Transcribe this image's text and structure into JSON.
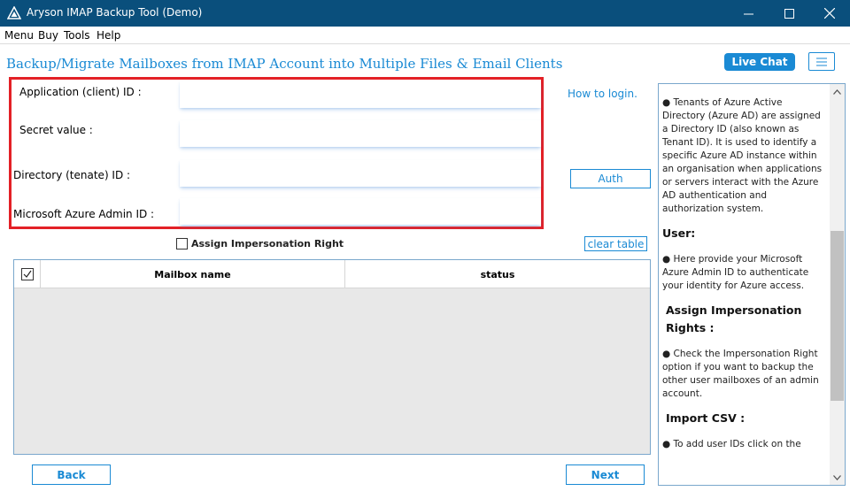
{
  "window": {
    "title": "Aryson IMAP Backup Tool (Demo)",
    "minimize_glyph": "—",
    "maximize_glyph": "☐",
    "close_glyph": "✕"
  },
  "menu": {
    "items": [
      "Menu",
      "Buy",
      "Tools",
      "Help"
    ]
  },
  "header": {
    "title": "Backup/Migrate Mailboxes from IMAP Account into Multiple Files & Email Clients",
    "live_chat_label": "Live Chat",
    "accent_color": "#1a8ad4",
    "titlebar_color": "#0a4f7c"
  },
  "credentials": {
    "highlight_color": "#e32026",
    "fields": [
      {
        "label": "Application (client) ID :",
        "value": ""
      },
      {
        "label": "Secret value :",
        "value": ""
      },
      {
        "label": "Directory (tenate) ID :",
        "value": ""
      },
      {
        "label": "Microsoft Azure Admin ID :",
        "value": ""
      }
    ]
  },
  "actions": {
    "how_to_login": "How to login.",
    "auth_label": "Auth",
    "impersonation_label": "Assign Impersonation Right",
    "impersonation_checked": false,
    "clear_table_label": "clear table"
  },
  "table": {
    "columns": [
      "Mailbox name",
      "status"
    ],
    "header_checked": true,
    "rows": []
  },
  "nav": {
    "back_label": "Back",
    "next_label": "Next"
  },
  "help": {
    "intro": "● Tenants of Azure Active Directory (Azure AD) are assigned a Directory ID (also known as Tenant ID). It is used to identify a specific Azure AD instance within an organisation when applications or servers interact with the Azure AD authentication and authorization system.",
    "user_heading": "User:",
    "user_text": "● Here provide your Microsoft Azure Admin ID to authenticate your identity for Azure access.",
    "impersonation_heading": "Assign Impersonation Rights :",
    "impersonation_text": "● Check the Impersonation Right option if you want to backup the other user mailboxes of an admin account.",
    "csv_heading": "Import CSV :",
    "csv_text": "● To add user IDs click on the"
  }
}
